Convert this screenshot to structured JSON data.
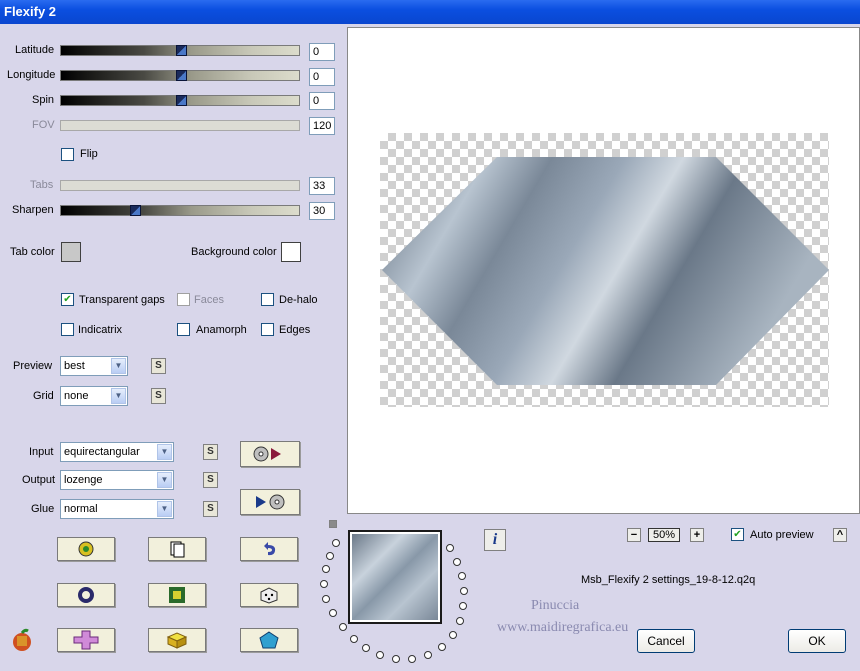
{
  "window": {
    "title": "Flexify 2"
  },
  "sliders": [
    {
      "label": "Latitude",
      "value": "0",
      "position": 0.5,
      "enabled": true
    },
    {
      "label": "Longitude",
      "value": "0",
      "position": 0.5,
      "enabled": true
    },
    {
      "label": "Spin",
      "value": "0",
      "position": 0.5,
      "enabled": true
    },
    {
      "label": "FOV",
      "value": "120",
      "enabled": false
    },
    {
      "label": "Tabs",
      "value": "33",
      "enabled": false
    },
    {
      "label": "Sharpen",
      "value": "30",
      "position": 0.3,
      "enabled": true
    }
  ],
  "flip": {
    "label": "Flip",
    "checked": false
  },
  "tab_color": {
    "label": "Tab color",
    "color": "#c8c8c8"
  },
  "background_color": {
    "label": "Background color",
    "color": "#ffffff"
  },
  "options": {
    "transparent_gaps": {
      "label": "Transparent gaps",
      "checked": true
    },
    "faces": {
      "label": "Faces",
      "checked": false
    },
    "de_halo": {
      "label": "De-halo",
      "checked": false
    },
    "indicatrix": {
      "label": "Indicatrix",
      "checked": false
    },
    "anamorph": {
      "label": "Anamorph",
      "checked": false
    },
    "edges": {
      "label": "Edges",
      "checked": false
    }
  },
  "preview_select": {
    "label": "Preview",
    "value": "best"
  },
  "grid_select": {
    "label": "Grid",
    "value": "none"
  },
  "input_select": {
    "label": "Input",
    "value": "equirectangular"
  },
  "output_select": {
    "label": "Output",
    "value": "lozenge"
  },
  "glue_select": {
    "label": "Glue",
    "value": "normal"
  },
  "s_label": "S",
  "zoom": {
    "minus": "−",
    "value": "50%",
    "plus": "+"
  },
  "auto_preview": {
    "label": "Auto preview",
    "checked": true
  },
  "collapse": "^",
  "info": "i",
  "settings_file": "Msb_Flexify 2 settings_19-8-12.q2q",
  "watermark": {
    "line1": "Pinuccia",
    "line2": "www.maidiregrafica.eu"
  },
  "buttons": {
    "cancel": "Cancel",
    "ok": "OK"
  },
  "colors": {
    "accent": "#0a46cf",
    "panel": "#d8d6ea",
    "preview_shape": "#8a98a8"
  }
}
